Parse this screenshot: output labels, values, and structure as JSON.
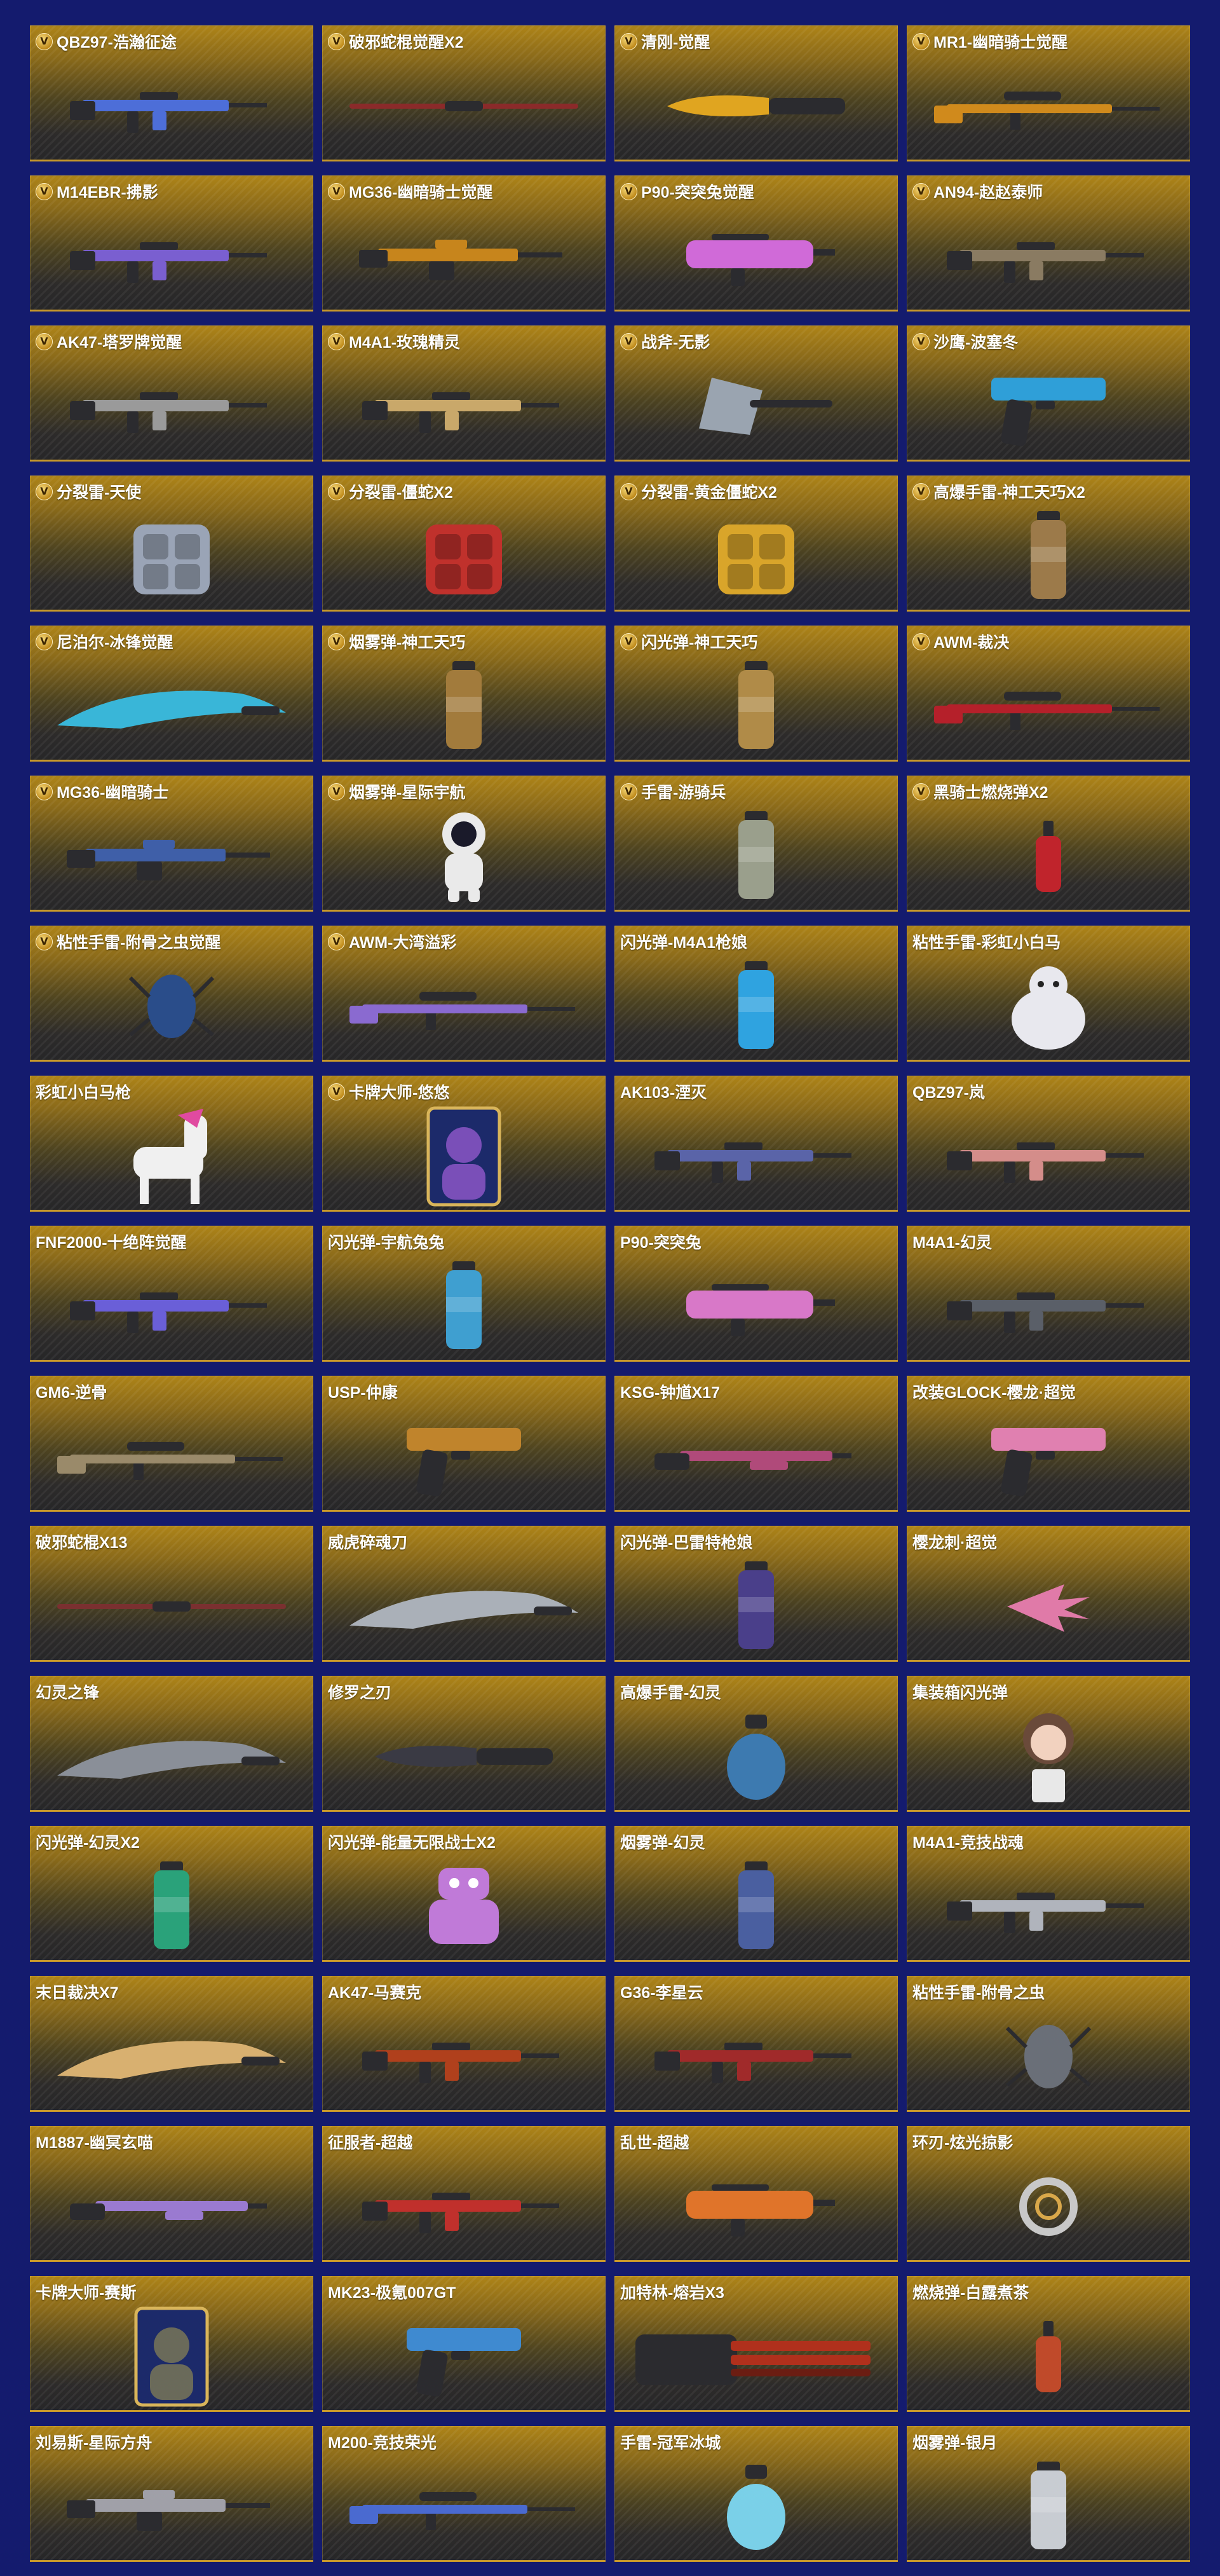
{
  "theme": {
    "background": "#141b6e",
    "card_gold": "#ae8418",
    "card_dark": "#262628",
    "badge_gold": "#e7b940"
  },
  "items": [
    {
      "name": "QBZ97-浩瀚征途",
      "badge": "V",
      "icon": "rifle-icon",
      "color": "#4d6ed8"
    },
    {
      "name": "破邪蛇棍觉醒X2",
      "badge": "V",
      "icon": "staff-icon",
      "color": "#8b2a2a"
    },
    {
      "name": "清刚-觉醒",
      "badge": "V",
      "icon": "knife-icon",
      "color": "#e0a520"
    },
    {
      "name": "MR1-幽暗骑士觉醒",
      "badge": "V",
      "icon": "sniper-icon",
      "color": "#d08a1c"
    },
    {
      "name": "M14EBR-拂影",
      "badge": "V",
      "icon": "rifle-icon",
      "color": "#7a5fd0"
    },
    {
      "name": "MG36-幽暗骑士觉醒",
      "badge": "V",
      "icon": "machine-gun-icon",
      "color": "#c7851c"
    },
    {
      "name": "P90-突突兔觉醒",
      "badge": "V",
      "icon": "smg-icon",
      "color": "#d06ad8"
    },
    {
      "name": "AN94-赵赵泰师",
      "badge": "V",
      "icon": "rifle-icon",
      "color": "#8a7b62"
    },
    {
      "name": "AK47-塔罗牌觉醒",
      "badge": "V",
      "icon": "rifle-icon",
      "color": "#9a9a9a"
    },
    {
      "name": "M4A1-玫瑰精灵",
      "badge": "V",
      "icon": "rifle-icon",
      "color": "#c9a86a"
    },
    {
      "name": "战斧-无影",
      "badge": "V",
      "icon": "axe-icon",
      "color": "#9aa4b0"
    },
    {
      "name": "沙鹰-波塞冬",
      "badge": "V",
      "icon": "pistol-icon",
      "color": "#2f9fd8"
    },
    {
      "name": "分裂雷-天使",
      "badge": "V",
      "icon": "cluster-grenade-icon",
      "color": "#9aa4b6"
    },
    {
      "name": "分裂雷-僵蛇X2",
      "badge": "V",
      "icon": "cluster-grenade-icon",
      "color": "#c0312c"
    },
    {
      "name": "分裂雷-黄金僵蛇X2",
      "badge": "V",
      "icon": "cluster-grenade-icon",
      "color": "#d9a52a"
    },
    {
      "name": "高爆手雷-神工天巧X2",
      "badge": "V",
      "icon": "grenade-canister-icon",
      "color": "#9c7a4a"
    },
    {
      "name": "尼泊尔-冰锋觉醒",
      "badge": "V",
      "icon": "blade-icon",
      "color": "#39b6d8"
    },
    {
      "name": "烟雾弹-神工天巧",
      "badge": "V",
      "icon": "smoke-canister-icon",
      "color": "#a27b3c"
    },
    {
      "name": "闪光弹-神工天巧",
      "badge": "V",
      "icon": "flash-canister-icon",
      "color": "#b08b48"
    },
    {
      "name": "AWM-裁决",
      "badge": "V",
      "icon": "sniper-icon",
      "color": "#b5202a"
    },
    {
      "name": "MG36-幽暗骑士",
      "badge": "V",
      "icon": "machine-gun-icon",
      "color": "#3f5fa8"
    },
    {
      "name": "烟雾弹-星际宇航",
      "badge": "V",
      "icon": "astronaut-icon",
      "color": "#eaeaea"
    },
    {
      "name": "手雷-游骑兵",
      "badge": "V",
      "icon": "grenade-canister-icon",
      "color": "#9a9f8c"
    },
    {
      "name": "黑骑士燃烧弹X2",
      "badge": "V",
      "icon": "molotov-icon",
      "color": "#c0242c"
    },
    {
      "name": "粘性手雷-附骨之虫觉醒",
      "badge": "V",
      "icon": "bug-grenade-icon",
      "color": "#2a4d8a"
    },
    {
      "name": "AWM-大湾溢彩",
      "badge": "V",
      "icon": "sniper-icon",
      "color": "#8a6ad0"
    },
    {
      "name": "闪光弹-M4A1枪娘",
      "badge": "",
      "icon": "flash-canister-icon",
      "color": "#2fa3e0"
    },
    {
      "name": "粘性手雷-彩虹小白马",
      "badge": "",
      "icon": "mascot-icon",
      "color": "#e8e8ee"
    },
    {
      "name": "彩虹小白马枪",
      "badge": "",
      "icon": "horse-icon",
      "color": "#f0f0f0"
    },
    {
      "name": "卡牌大师-悠悠",
      "badge": "V",
      "icon": "character-card-icon",
      "color": "#7a4fb8"
    },
    {
      "name": "AK103-湮灭",
      "badge": "",
      "icon": "rifle-icon",
      "color": "#5a64a8"
    },
    {
      "name": "QBZ97-岚",
      "badge": "",
      "icon": "rifle-icon",
      "color": "#d48d8a"
    },
    {
      "name": "FNF2000-十绝阵觉醒",
      "badge": "",
      "icon": "rifle-icon",
      "color": "#6a5fd8"
    },
    {
      "name": "闪光弹-宇航兔兔",
      "badge": "",
      "icon": "flash-canister-icon",
      "color": "#3f9fd0"
    },
    {
      "name": "P90-突突兔",
      "badge": "",
      "icon": "smg-icon",
      "color": "#d878c8"
    },
    {
      "name": "M4A1-幻灵",
      "badge": "",
      "icon": "rifle-icon",
      "color": "#5a5f68"
    },
    {
      "name": "GM6-逆骨",
      "badge": "",
      "icon": "sniper-icon",
      "color": "#9a8a6a"
    },
    {
      "name": "USP-仲康",
      "badge": "",
      "icon": "pistol-icon",
      "color": "#c0842c"
    },
    {
      "name": "KSG-钟馗X17",
      "badge": "",
      "icon": "shotgun-icon",
      "color": "#b04a7a"
    },
    {
      "name": "改装GLOCK-樱龙·超觉",
      "badge": "",
      "icon": "pistol-icon",
      "color": "#e080b0"
    },
    {
      "name": "破邪蛇棍X13",
      "badge": "",
      "icon": "staff-icon",
      "color": "#7a3030"
    },
    {
      "name": "威虎碎魂刀",
      "badge": "",
      "icon": "blade-icon",
      "color": "#aab0b8"
    },
    {
      "name": "闪光弹-巴雷特枪娘",
      "badge": "",
      "icon": "flash-canister-icon",
      "color": "#4a3f8a"
    },
    {
      "name": "樱龙刺·超觉",
      "badge": "",
      "icon": "claw-icon",
      "color": "#e07aa8"
    },
    {
      "name": "幻灵之锋",
      "badge": "",
      "icon": "blade-icon",
      "color": "#8a8f98"
    },
    {
      "name": "修罗之刃",
      "badge": "",
      "icon": "knife-icon",
      "color": "#3a3a44"
    },
    {
      "name": "高爆手雷-幻灵",
      "badge": "",
      "icon": "grenade-icon",
      "color": "#3d7ab0"
    },
    {
      "name": "集装箱闪光弹",
      "badge": "",
      "icon": "doll-icon",
      "color": "#c89a7a"
    },
    {
      "name": "闪光弹-幻灵X2",
      "badge": "",
      "icon": "flash-canister-icon",
      "color": "#2aa27a"
    },
    {
      "name": "闪光弹-能量无限战士X2",
      "badge": "",
      "icon": "robot-icon",
      "color": "#c07ad8"
    },
    {
      "name": "烟雾弹-幻灵",
      "badge": "",
      "icon": "smoke-canister-icon",
      "color": "#4a5fa0"
    },
    {
      "name": "M4A1-竞技战魂",
      "badge": "",
      "icon": "rifle-icon",
      "color": "#b0b4bc"
    },
    {
      "name": "末日裁决X7",
      "badge": "",
      "icon": "blade-icon",
      "color": "#d8b070"
    },
    {
      "name": "AK47-马赛克",
      "badge": "",
      "icon": "rifle-icon",
      "color": "#b0401c"
    },
    {
      "name": "G36-李星云",
      "badge": "",
      "icon": "rifle-icon",
      "color": "#a02a2a"
    },
    {
      "name": "粘性手雷-附骨之虫",
      "badge": "",
      "icon": "bug-grenade-icon",
      "color": "#6a6f78"
    },
    {
      "name": "M1887-幽冥玄喵",
      "badge": "",
      "icon": "shotgun-icon",
      "color": "#9a7ad0"
    },
    {
      "name": "征服者-超越",
      "badge": "",
      "icon": "rifle-icon",
      "color": "#c0302c"
    },
    {
      "name": "乱世-超越",
      "badge": "",
      "icon": "smg-icon",
      "color": "#e0742a"
    },
    {
      "name": "环刃-炫光掠影",
      "badge": "",
      "icon": "ring-blade-icon",
      "color": "#c8c8c8"
    },
    {
      "name": "卡牌大师-赛斯",
      "badge": "",
      "icon": "character-card-icon",
      "color": "#6a6a5a"
    },
    {
      "name": "MK23-极氪007GT",
      "badge": "",
      "icon": "pistol-icon",
      "color": "#3f8ad0"
    },
    {
      "name": "加特林-熔岩X3",
      "badge": "",
      "icon": "gatling-icon",
      "color": "#b0301c"
    },
    {
      "name": "燃烧弹-白露煮茶",
      "badge": "",
      "icon": "molotov-icon",
      "color": "#c04a2a"
    },
    {
      "name": "刘易斯-星际方舟",
      "badge": "",
      "icon": "machine-gun-icon",
      "color": "#a0a0a8"
    },
    {
      "name": "M200-竞技荣光",
      "badge": "",
      "icon": "sniper-icon",
      "color": "#4a6ad0"
    },
    {
      "name": "手雷-冠军冰城",
      "badge": "",
      "icon": "grenade-icon",
      "color": "#7ad0e8"
    },
    {
      "name": "烟雾弹-银月",
      "badge": "",
      "icon": "smoke-canister-icon",
      "color": "#c8ccd2"
    }
  ]
}
